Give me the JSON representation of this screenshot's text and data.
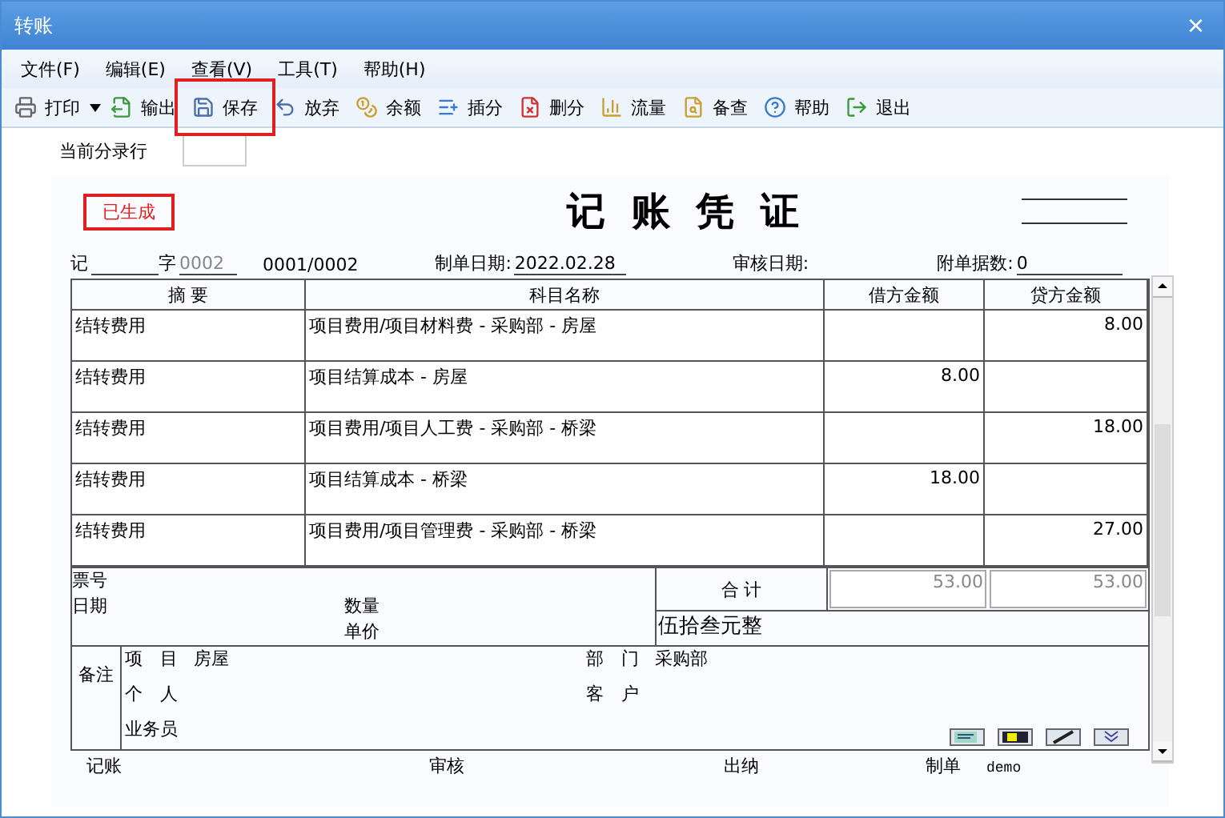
{
  "window": {
    "title": "转账",
    "close": "×"
  },
  "menu": [
    {
      "label": "文件(F)"
    },
    {
      "label": "编辑(E)"
    },
    {
      "label": "查看(V)"
    },
    {
      "label": "工具(T)"
    },
    {
      "label": "帮助(H)"
    }
  ],
  "toolbar": [
    {
      "label": "打印",
      "kind": "printer",
      "dropdown": true,
      "highlighted": false
    },
    {
      "label": "输出",
      "kind": "export",
      "dropdown": false,
      "highlighted": false
    },
    {
      "label": "保存",
      "kind": "save",
      "dropdown": false,
      "highlighted": true
    },
    {
      "label": "放弃",
      "kind": "discard",
      "dropdown": false,
      "highlighted": false
    },
    {
      "label": "余额",
      "kind": "coins",
      "dropdown": false,
      "highlighted": false
    },
    {
      "label": "插分",
      "kind": "insert",
      "dropdown": false,
      "highlighted": false
    },
    {
      "label": "删分",
      "kind": "delete",
      "dropdown": false,
      "highlighted": false
    },
    {
      "label": "流量",
      "kind": "flow",
      "dropdown": false,
      "highlighted": false
    },
    {
      "label": "备查",
      "kind": "lookup",
      "dropdown": false,
      "highlighted": false
    },
    {
      "label": "帮助",
      "kind": "help",
      "dropdown": false,
      "highlighted": false
    },
    {
      "label": "退出",
      "kind": "exit",
      "dropdown": false,
      "highlighted": false
    }
  ],
  "current_row": {
    "label": "当前分录行"
  },
  "voucher": {
    "status": "已生成",
    "title": "记 账 凭 证",
    "type": "记",
    "zi": "字",
    "number": "0002",
    "page": "0001/0002",
    "date_label": "制单日期:",
    "date": "2022.02.28",
    "audit_label": "审核日期:",
    "attach_label": "附单据数:",
    "attach": "0",
    "columns": [
      "摘 要",
      "科目名称",
      "借方金额",
      "贷方金额"
    ],
    "rows": [
      {
        "summary": "结转费用",
        "account": "项目费用/项目材料费 - 采购部 - 房屋",
        "credit": "8.00"
      },
      {
        "summary": "结转费用",
        "account": "项目结算成本 - 房屋",
        "debit": "8.00"
      },
      {
        "summary": "结转费用",
        "account": "项目费用/项目人工费 - 采购部 - 桥梁",
        "credit": "18.00"
      },
      {
        "summary": "结转费用",
        "account": "项目结算成本 - 桥梁",
        "debit": "18.00"
      },
      {
        "summary": "结转费用",
        "account": "项目费用/项目管理费 - 采购部 - 桥梁",
        "credit": "27.00"
      }
    ],
    "ticket_label": "票号",
    "date2_label": "日期",
    "qty_label": "数量",
    "price_label": "单价",
    "total_label": "合 计",
    "total_debit": "53.00",
    "total_credit": "53.00",
    "amount_words": "伍拾叁元整",
    "remarks_label": "备注",
    "fields": [
      {
        "label": "项　目",
        "value": "房屋"
      },
      {
        "label": "部　门",
        "value": "采购部"
      },
      {
        "label": "个　人"
      },
      {
        "label": "客　户"
      },
      {
        "label": "业务员"
      }
    ],
    "signatures": [
      {
        "label": "记账"
      },
      {
        "label": "审核"
      },
      {
        "label": "出纳"
      },
      {
        "label": "制单",
        "value": "demo"
      }
    ]
  }
}
